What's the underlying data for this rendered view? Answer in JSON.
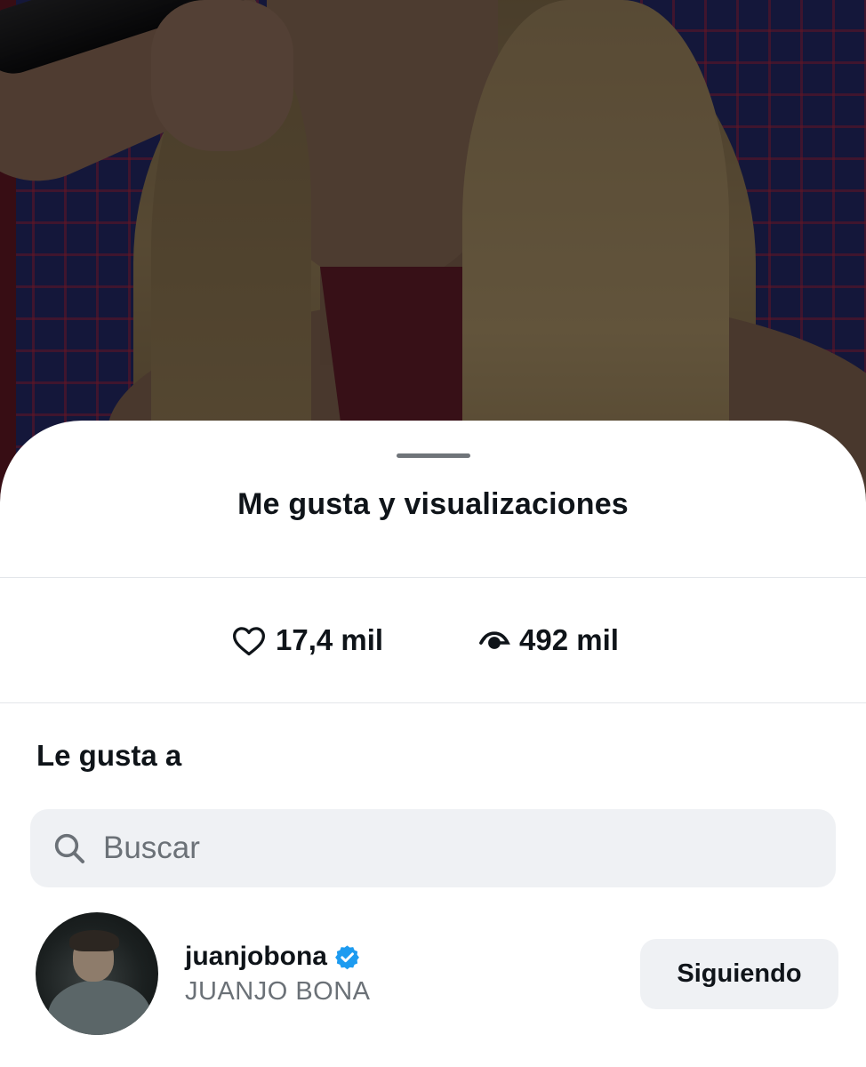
{
  "background_photo": {
    "description_icon": "photo"
  },
  "sheet": {
    "title": "Me gusta y visualizaciones"
  },
  "stats": {
    "likes": {
      "icon": "heart-outline-icon",
      "value": "17,4 mil"
    },
    "views": {
      "icon": "eye-icon",
      "value": "492 mil"
    }
  },
  "liked_by": {
    "title": "Le gusta a",
    "search": {
      "placeholder": "Buscar",
      "value": ""
    },
    "users": [
      {
        "username": "juanjobona",
        "verified": true,
        "display_name": "JUANJO BONA",
        "follow_label": "Siguiendo"
      }
    ]
  },
  "colors": {
    "text_primary": "#0f1419",
    "text_secondary": "#6b7177",
    "field_background": "#eff1f4",
    "verified_badge": "#1d9bf0",
    "divider": "#e3e6ea"
  }
}
